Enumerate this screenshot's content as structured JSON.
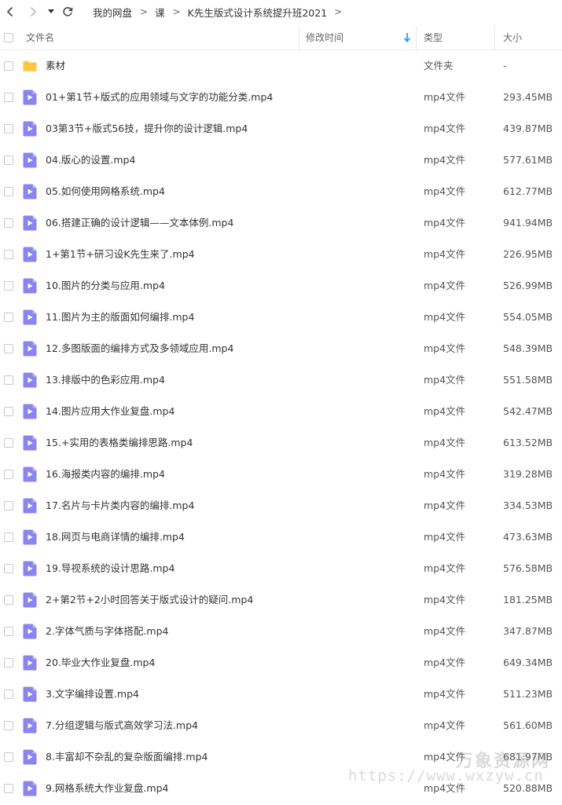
{
  "nav": {
    "back_icon": "chevron-left-icon",
    "forward_icon": "chevron-right-icon",
    "dropdown_icon": "caret-down-icon",
    "refresh_icon": "refresh-icon",
    "breadcrumbs": [
      "我的网盘",
      "课",
      "K先生版式设计系统提升班2021"
    ],
    "separator": ">"
  },
  "header": {
    "name": "文件名",
    "modified": "修改时间",
    "type": "类型",
    "size": "大小",
    "sort_icon": "sort-down-arrow-icon",
    "accent_color": "#1a8cff"
  },
  "files": [
    {
      "name": "素材",
      "type": "文件夹",
      "size": "-",
      "icon": "folder-icon"
    },
    {
      "name": "01+第1节+版式的应用领域与文字的功能分类.mp4",
      "type": "mp4文件",
      "size": "293.45MB",
      "icon": "video-file-icon"
    },
    {
      "name": "03第3节+版式56技，提升你的设计逻辑.mp4",
      "type": "mp4文件",
      "size": "439.87MB",
      "icon": "video-file-icon"
    },
    {
      "name": "04.版心的设置.mp4",
      "type": "mp4文件",
      "size": "577.61MB",
      "icon": "video-file-icon"
    },
    {
      "name": "05.如何使用网格系统.mp4",
      "type": "mp4文件",
      "size": "612.77MB",
      "icon": "video-file-icon"
    },
    {
      "name": "06.搭建正确的设计逻辑——文本体例.mp4",
      "type": "mp4文件",
      "size": "941.94MB",
      "icon": "video-file-icon"
    },
    {
      "name": "1+第1节+研习设K先生来了.mp4",
      "type": "mp4文件",
      "size": "226.95MB",
      "icon": "video-file-icon"
    },
    {
      "name": "10.图片的分类与应用.mp4",
      "type": "mp4文件",
      "size": "526.99MB",
      "icon": "video-file-icon"
    },
    {
      "name": "11.图片为主的版面如何编排.mp4",
      "type": "mp4文件",
      "size": "554.05MB",
      "icon": "video-file-icon"
    },
    {
      "name": "12.多图版面的编排方式及多领域应用.mp4",
      "type": "mp4文件",
      "size": "548.39MB",
      "icon": "video-file-icon"
    },
    {
      "name": "13.排版中的色彩应用.mp4",
      "type": "mp4文件",
      "size": "551.58MB",
      "icon": "video-file-icon"
    },
    {
      "name": "14.图片应用大作业复盘.mp4",
      "type": "mp4文件",
      "size": "542.47MB",
      "icon": "video-file-icon"
    },
    {
      "name": "15.+实用的表格类编排思路.mp4",
      "type": "mp4文件",
      "size": "613.52MB",
      "icon": "video-file-icon"
    },
    {
      "name": "16.海报类内容的编排.mp4",
      "type": "mp4文件",
      "size": "319.28MB",
      "icon": "video-file-icon"
    },
    {
      "name": "17.名片与卡片类内容的编排.mp4",
      "type": "mp4文件",
      "size": "334.53MB",
      "icon": "video-file-icon"
    },
    {
      "name": "18.网页与电商详情的编排.mp4",
      "type": "mp4文件",
      "size": "473.63MB",
      "icon": "video-file-icon"
    },
    {
      "name": "19.导视系统的设计思路.mp4",
      "type": "mp4文件",
      "size": "576.58MB",
      "icon": "video-file-icon"
    },
    {
      "name": "2+第2节+2小时回答关于版式设计的疑问.mp4",
      "type": "mp4文件",
      "size": "181.25MB",
      "icon": "video-file-icon"
    },
    {
      "name": "2.字体气质与字体搭配.mp4",
      "type": "mp4文件",
      "size": "347.87MB",
      "icon": "video-file-icon"
    },
    {
      "name": "20.毕业大作业复盘.mp4",
      "type": "mp4文件",
      "size": "649.34MB",
      "icon": "video-file-icon"
    },
    {
      "name": "3.文字编排设置.mp4",
      "type": "mp4文件",
      "size": "511.23MB",
      "icon": "video-file-icon"
    },
    {
      "name": "7.分组逻辑与版式高效学习法.mp4",
      "type": "mp4文件",
      "size": "561.60MB",
      "icon": "video-file-icon"
    },
    {
      "name": "8.丰富却不杂乱的复杂版面编排.mp4",
      "type": "mp4文件",
      "size": "681.97MB",
      "icon": "video-file-icon"
    },
    {
      "name": "9.网格系统大作业复盘.mp4",
      "type": "mp4文件",
      "size": "520.88MB",
      "icon": "video-file-icon"
    }
  ],
  "watermark": {
    "title": "万象资源网",
    "url": "https://www.wxzyw.cn"
  },
  "colors": {
    "folder": "#ffc940",
    "video_icon": "#8b84ee",
    "video_icon_fold": "#b7b1f7"
  }
}
